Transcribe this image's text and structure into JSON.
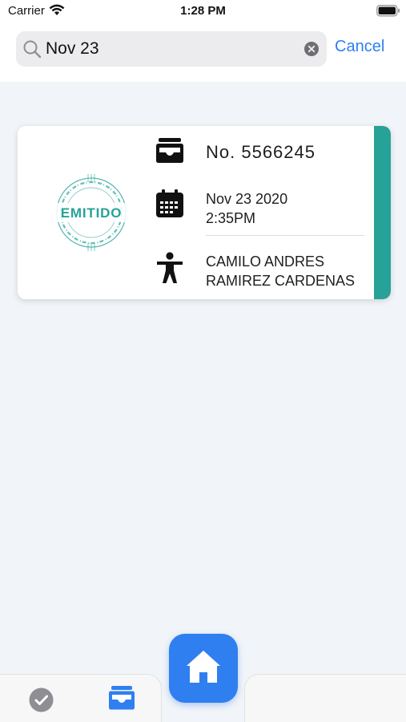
{
  "status_bar": {
    "carrier": "Carrier",
    "time": "1:28 PM",
    "icons": [
      "wifi-icon",
      "battery-icon"
    ]
  },
  "search": {
    "value": "Nov 23",
    "placeholder": "",
    "cancel_label": "Cancel",
    "icons": [
      "search-icon",
      "clear-icon"
    ]
  },
  "results": [
    {
      "stamp_label": "EMITIDO",
      "ticket_number": "No. 5566245",
      "date_line1": "Nov 23 2020",
      "date_line2": "2:35PM",
      "name_line1": "CAMILO ANDRES",
      "name_line2": "RAMIREZ CARDENAS",
      "icons": [
        "ticket-icon",
        "calendar-icon",
        "person-icon"
      ]
    }
  ],
  "tab_bar": {
    "icons": [
      "check-icon",
      "inbox-icon",
      "home-icon"
    ],
    "active": "inbox-icon"
  },
  "colors": {
    "accent": "#27a298",
    "primary": "#2f7ff0",
    "background": "#f1f4f8",
    "stamp": "#27a298"
  }
}
